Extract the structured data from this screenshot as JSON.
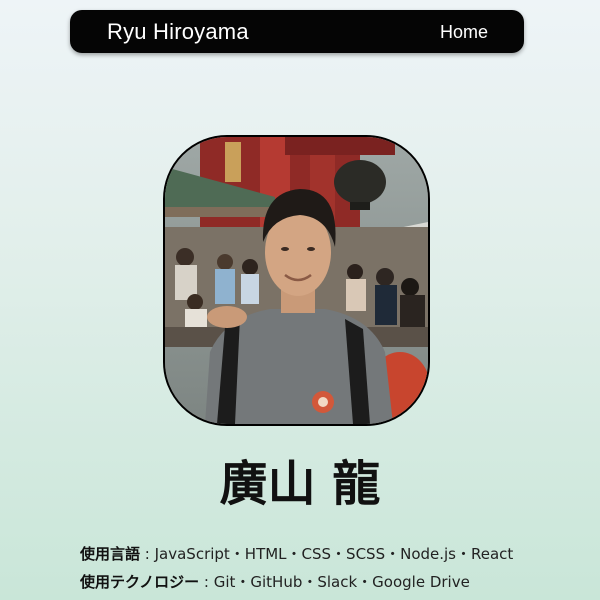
{
  "navbar": {
    "brand": "Ryu Hiroyama",
    "links": [
      {
        "label": "Home"
      }
    ]
  },
  "profile": {
    "photo_alt": "廣山 龍",
    "name": "廣山 龍"
  },
  "skills": {
    "languages": {
      "label": "使用言語",
      "separator": " : ",
      "value": "JavaScript・HTML・CSS・SCSS・Node.js・React"
    },
    "technologies": {
      "label": "使用テクノロジー",
      "separator": " : ",
      "value": "Git・GitHub・Slack・Google Drive"
    }
  },
  "colors": {
    "navbar_bg": "#050505",
    "navbar_text": "#ffffff",
    "page_gradient_top": "#eef4f7",
    "page_gradient_bottom": "#c9e6d8"
  }
}
